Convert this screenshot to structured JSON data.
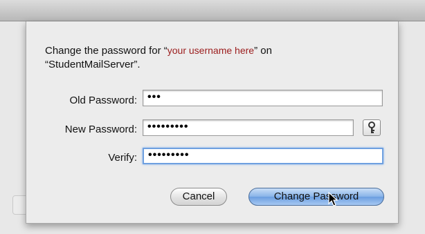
{
  "dialog": {
    "message_prefix": "Change the password for “",
    "username": "your username here",
    "message_middle": "” on",
    "message_server": "“StudentMailServer”.",
    "old_password": {
      "label": "Old Password:",
      "value": "•••"
    },
    "new_password": {
      "label": "New Password:",
      "value": "•••••••••"
    },
    "verify": {
      "label": "Verify:",
      "value": "•••••••••"
    },
    "key_icon": "key-icon",
    "cancel_label": "Cancel",
    "change_label": "Change Password"
  },
  "colors": {
    "username": "#9b1c1c",
    "primary_button": "#88b3e8",
    "focus_ring": "#6fa0e0"
  }
}
